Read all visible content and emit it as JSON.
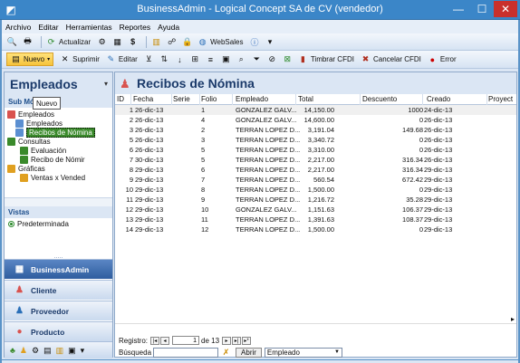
{
  "window": {
    "title": "BusinessAdmin - Logical Concept SA de CV (vendedor)"
  },
  "menu": [
    "Archivo",
    "Editar",
    "Herramientas",
    "Reportes",
    "Ayuda"
  ],
  "toolbar1": {
    "actualizar": "Actualizar",
    "websales": "WebSales"
  },
  "toolbar2": {
    "nuevo": "Nuevo",
    "suprimir": "Suprimir",
    "editar": "Editar",
    "timbrar": "Timbrar CFDI",
    "cancelar": "Cancelar CFDI",
    "error": "Error"
  },
  "tooltip": "Nuevo",
  "left": {
    "header": "Empleados",
    "sub_title": "Sub Módulos",
    "tree": [
      {
        "label": "Empleados"
      },
      {
        "label": "Empleados"
      },
      {
        "label": "Recibos de Nómina"
      },
      {
        "label": "Consultas"
      },
      {
        "label": "Evaluación"
      },
      {
        "label": "Recibo de Nómir"
      },
      {
        "label": "Gráficas"
      },
      {
        "label": "Ventas x Vended"
      }
    ],
    "vistas_title": "Vistas",
    "vistas_item": "Predeterminada",
    "dots": ".....",
    "nav": [
      "BusinessAdmin",
      "Cliente",
      "Proveedor",
      "Producto"
    ]
  },
  "main": {
    "title": "Recibos de Nómina",
    "columns": [
      "ID",
      "Fecha",
      "Serie",
      "Folio",
      "Empleado",
      "Total",
      "Descuento",
      "Creado",
      "Proyect"
    ],
    "rows": [
      {
        "id": "1",
        "fecha": "26-dic-13",
        "folio": "1",
        "empleado": "GONZALEZ GALV...",
        "total": "14,150.00",
        "descuento": "1000",
        "creado": "24-dic-13"
      },
      {
        "id": "2",
        "fecha": "26-dic-13",
        "folio": "4",
        "empleado": "GONZALEZ GALV...",
        "total": "14,600.00",
        "descuento": "0",
        "creado": "26-dic-13"
      },
      {
        "id": "3",
        "fecha": "26-dic-13",
        "folio": "2",
        "empleado": "TERRAN LOPEZ D...",
        "total": "3,191.04",
        "descuento": "149.68",
        "creado": "26-dic-13"
      },
      {
        "id": "5",
        "fecha": "26-dic-13",
        "folio": "3",
        "empleado": "TERRAN LOPEZ D...",
        "total": "3,340.72",
        "descuento": "0",
        "creado": "26-dic-13"
      },
      {
        "id": "6",
        "fecha": "26-dic-13",
        "folio": "5",
        "empleado": "TERRAN LOPEZ D...",
        "total": "3,310.00",
        "descuento": "0",
        "creado": "26-dic-13"
      },
      {
        "id": "7",
        "fecha": "30-dic-13",
        "folio": "5",
        "empleado": "TERRAN LOPEZ D...",
        "total": "2,217.00",
        "descuento": "316.34",
        "creado": "26-dic-13"
      },
      {
        "id": "8",
        "fecha": "29-dic-13",
        "folio": "6",
        "empleado": "TERRAN LOPEZ D...",
        "total": "2,217.00",
        "descuento": "316.34",
        "creado": "29-dic-13"
      },
      {
        "id": "9",
        "fecha": "29-dic-13",
        "folio": "7",
        "empleado": "TERRAN LOPEZ D...",
        "total": "560.54",
        "descuento": "672.42",
        "creado": "29-dic-13"
      },
      {
        "id": "10",
        "fecha": "29-dic-13",
        "folio": "8",
        "empleado": "TERRAN LOPEZ D...",
        "total": "1,500.00",
        "descuento": "0",
        "creado": "29-dic-13"
      },
      {
        "id": "11",
        "fecha": "29-dic-13",
        "folio": "9",
        "empleado": "TERRAN LOPEZ D...",
        "total": "1,216.72",
        "descuento": "35.28",
        "creado": "29-dic-13"
      },
      {
        "id": "12",
        "fecha": "29-dic-13",
        "folio": "10",
        "empleado": "GONZALEZ GALV...",
        "total": "1,151.63",
        "descuento": "106.37",
        "creado": "29-dic-13"
      },
      {
        "id": "13",
        "fecha": "29-dic-13",
        "folio": "11",
        "empleado": "TERRAN LOPEZ D...",
        "total": "1,391.63",
        "descuento": "108.37",
        "creado": "29-dic-13"
      },
      {
        "id": "14",
        "fecha": "29-dic-13",
        "folio": "12",
        "empleado": "TERRAN LOPEZ D...",
        "total": "1,500.00",
        "descuento": "0",
        "creado": "29-dic-13"
      }
    ],
    "footer": {
      "registro_label": "Registro:",
      "record_value": "1",
      "of_label": "de 13",
      "busqueda_label": "Búsqueda",
      "abrir": "Abrir",
      "combo_value": "Empleado"
    }
  },
  "colors": {
    "title_bar": "#3b86c8",
    "selected_node": "#3a8a2b",
    "close": "#c9302c"
  }
}
